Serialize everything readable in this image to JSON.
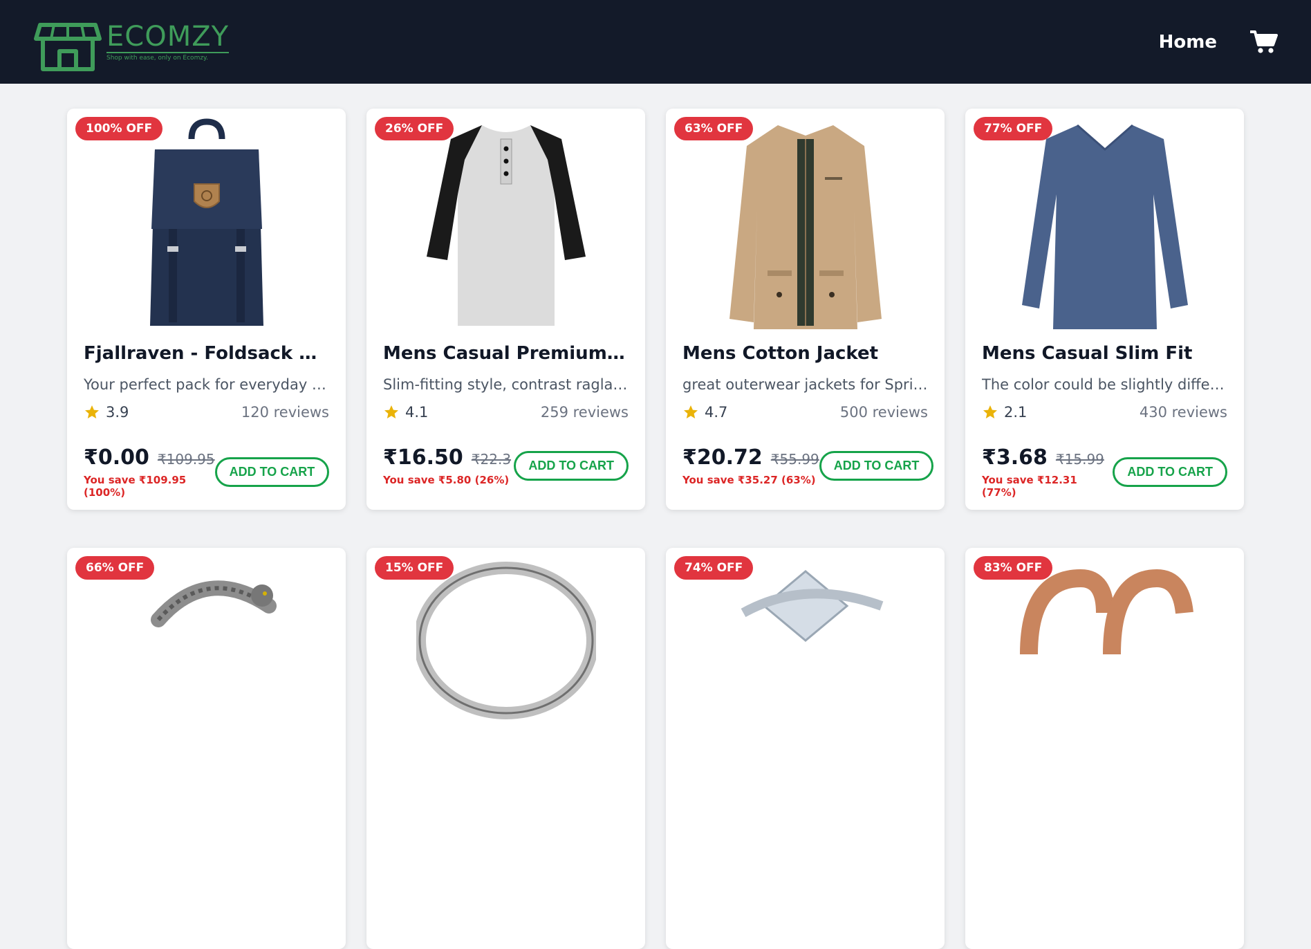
{
  "brand": {
    "name": "ECOMZY",
    "tagline": "Shop with ease, only on Ecomzy."
  },
  "nav": {
    "home_label": "Home"
  },
  "colors": {
    "header_bg": "#131a29",
    "brand": "#3f9c5a",
    "badge": "#e1353f",
    "accent": "#16a34a",
    "save": "#dc2626"
  },
  "products": [
    {
      "badge": "100% OFF",
      "title": "Fjallraven - Foldsack No....",
      "desc": "Your perfect pack for everyday u...",
      "rating": "3.9",
      "reviews": "120 reviews",
      "price": "₹0.00",
      "old_price": "₹109.95",
      "save": "You save ₹109.95 (100%)",
      "button": "ADD TO CART",
      "image": "backpack"
    },
    {
      "badge": "26% OFF",
      "title": "Mens Casual Premium S...",
      "desc": "Slim-fitting style, contrast raglan...",
      "rating": "4.1",
      "reviews": "259 reviews",
      "price": "₹16.50",
      "old_price": "₹22.3",
      "save": "You save ₹5.80 (26%)",
      "button": "ADD TO CART",
      "image": "raglan-tshirt"
    },
    {
      "badge": "63% OFF",
      "title": "Mens Cotton Jacket",
      "desc": "great outerwear jackets for Sprin...",
      "rating": "4.7",
      "reviews": "500 reviews",
      "price": "₹20.72",
      "old_price": "₹55.99",
      "save": "You save ₹35.27 (63%)",
      "button": "ADD TO CART",
      "image": "jacket"
    },
    {
      "badge": "77% OFF",
      "title": "Mens Casual Slim Fit",
      "desc": "The color could be slightly differ...",
      "rating": "2.1",
      "reviews": "430 reviews",
      "price": "₹3.68",
      "old_price": "₹15.99",
      "save": "You save ₹12.31 (77%)",
      "button": "ADD TO CART",
      "image": "longsleeve"
    },
    {
      "badge": "66% OFF",
      "image": "bracelet"
    },
    {
      "badge": "15% OFF",
      "image": "ring-silver"
    },
    {
      "badge": "74% OFF",
      "image": "ring-diamond"
    },
    {
      "badge": "83% OFF",
      "image": "earrings"
    }
  ]
}
